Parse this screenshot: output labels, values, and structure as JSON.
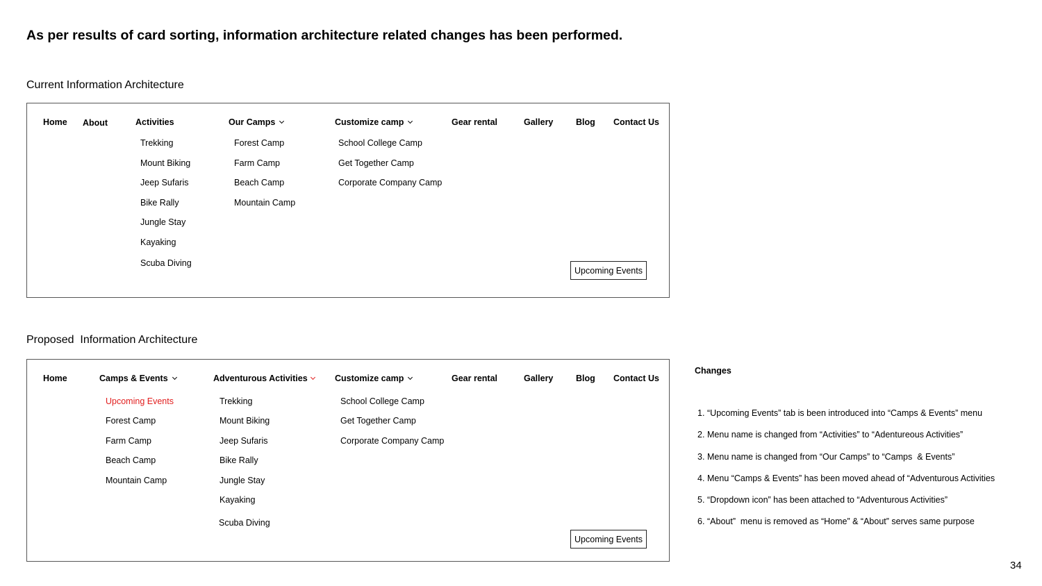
{
  "heading": "As per results of card sorting, information architecture related changes has been performed.",
  "current": {
    "label": "Current Information Architecture",
    "nav": {
      "home": "Home",
      "about": "About",
      "activities": "Activities",
      "our_camps": "Our Camps",
      "customize_camp": "Customize camp",
      "gear_rental": "Gear rental",
      "gallery": "Gallery",
      "blog": "Blog",
      "contact_us": "Contact Us"
    },
    "activities_items": [
      "Trekking",
      "Mount Biking",
      "Jeep Sufaris",
      "Bike Rally",
      "Jungle Stay",
      "Kayaking",
      "Scuba Diving"
    ],
    "camps_items": [
      "Forest Camp",
      "Farm Camp",
      "Beach Camp",
      "Mountain Camp"
    ],
    "customize_items": [
      "School College Camp",
      "Get Together Camp",
      "Corporate Company Camp"
    ],
    "upcoming_button": "Upcoming Events"
  },
  "proposed": {
    "label": "Proposed  Information Architecture",
    "nav": {
      "home": "Home",
      "camps_events": "Camps & Events",
      "adventurous_activities": "Adventurous Activities",
      "customize_camp": "Customize camp",
      "gear_rental": "Gear rental",
      "gallery": "Gallery",
      "blog": "Blog",
      "contact_us": "Contact Us"
    },
    "camps_items": [
      "Upcoming Events",
      "Forest Camp",
      "Farm Camp",
      "Beach Camp",
      "Mountain Camp"
    ],
    "activities_items": [
      "Trekking",
      "Mount Biking",
      "Jeep Sufaris",
      "Bike Rally",
      "Jungle Stay",
      "Kayaking",
      "Scuba Diving"
    ],
    "customize_items": [
      "School College Camp",
      "Get Together Camp",
      "Corporate Company Camp"
    ],
    "upcoming_button": "Upcoming Events"
  },
  "changes": {
    "title": "Changes",
    "items": [
      "“Upcoming Events” tab is been introduced into “Camps & Events” menu",
      "Menu name is changed from “Activities” to “Adentureous Activities”",
      "Menu name is changed from “Our Camps” to “Camps  & Events”",
      "Menu “Camps & Events” has been moved ahead of “Adventurous Activities",
      "“Dropdown icon” has been attached to “Adventurous Activities”",
      "“About”  menu is removed as “Home” & “About” serves same purpose"
    ]
  },
  "page_number": "34",
  "colors": {
    "highlight": "#e11d1d",
    "border": "#555555"
  }
}
